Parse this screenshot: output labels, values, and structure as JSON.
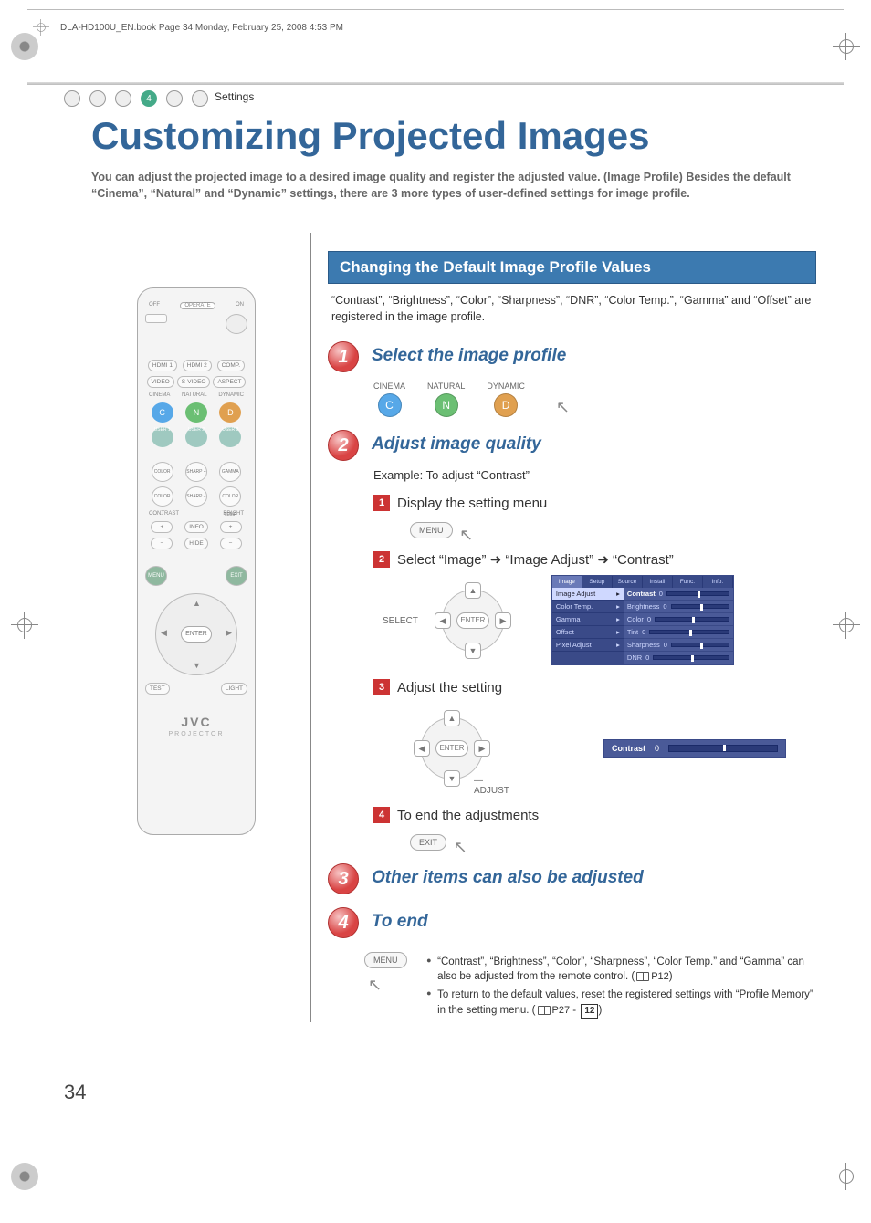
{
  "book_header": "DLA-HD100U_EN.book  Page 34  Monday, February 25, 2008  4:53 PM",
  "breadcrumb": {
    "step_number": "4",
    "label": "Settings"
  },
  "title": "Customizing Projected Images",
  "intro": "You can adjust the projected image to a desired image quality and register the adjusted value. (Image Profile)  Besides the default “Cinema”, “Natural” and “Dynamic” settings, there are 3 more types of user-defined settings for image profile.",
  "section": {
    "bar": "Changing the Default Image Profile Values",
    "desc": "“Contrast”, “Brightness”, “Color”, “Sharpness”, “DNR”, “Color Temp.”, “Gamma” and “Offset” are registered in the image profile."
  },
  "steps": {
    "s1": {
      "num": "1",
      "title": "Select the image profile",
      "profiles": [
        {
          "label": "CINEMA",
          "letter": "C",
          "cls": "c"
        },
        {
          "label": "NATURAL",
          "letter": "N",
          "cls": "n"
        },
        {
          "label": "DYNAMIC",
          "letter": "D",
          "cls": "d"
        }
      ]
    },
    "s2": {
      "num": "2",
      "title": "Adjust image quality",
      "example": "Example: To adjust “Contrast”",
      "sub1": {
        "n": "1",
        "text": "Display the setting menu",
        "btn": "MENU"
      },
      "sub2": {
        "n": "2",
        "text": "Select “Image” ➜ “Image Adjust” ➜ “Contrast”",
        "select_label": "SELECT",
        "enter": "ENTER"
      },
      "sub3": {
        "n": "3",
        "text": "Adjust the setting",
        "enter": "ENTER",
        "adjust": "ADJUST",
        "contrast_label": "Contrast",
        "contrast_value": "0"
      },
      "sub4": {
        "n": "4",
        "text": "To end the adjustments",
        "btn": "EXIT"
      }
    },
    "s3": {
      "num": "3",
      "title": "Other items can also be adjusted"
    },
    "s4": {
      "num": "4",
      "title": "To end",
      "btn": "MENU",
      "bullets": [
        "“Contrast”, “Brightness”, “Color”, “Sharpness”, “Color Temp.” and “Gamma” can also be adjusted from the remote control. (",
        "To return to the default values, reset the registered settings with “Profile Memory” in the setting menu. ("
      ],
      "ref1": "P12",
      "ref2": "P27",
      "ref2b": "12"
    }
  },
  "menu": {
    "tabs": [
      "Image",
      "Setup",
      "Source",
      "Install",
      "Func.",
      "Info."
    ],
    "left": [
      "Image Adjust",
      "Color Temp.",
      "Gamma",
      "Offset",
      "Pixel Adjust"
    ],
    "right": [
      {
        "lbl": "Contrast",
        "val": "0",
        "sel": true
      },
      {
        "lbl": "Brightness",
        "val": "0"
      },
      {
        "lbl": "Color",
        "val": "0"
      },
      {
        "lbl": "Tint",
        "val": "0"
      },
      {
        "lbl": "Sharpness",
        "val": "0"
      },
      {
        "lbl": "DNR",
        "val": "0"
      }
    ]
  },
  "remote": {
    "power": {
      "off": "OFF",
      "operate": "OPERATE",
      "on": "ON"
    },
    "inputs_row1": [
      "HDMI 1",
      "HDMI 2",
      "COMP."
    ],
    "inputs_row2": [
      "VIDEO",
      "S-VIDEO",
      "ASPECT"
    ],
    "profile_labels": [
      "CINEMA",
      "NATURAL",
      "DYNAMIC"
    ],
    "profiles": [
      {
        "l": "C",
        "c": "c"
      },
      {
        "l": "N",
        "c": "n"
      },
      {
        "l": "D",
        "c": "d"
      }
    ],
    "users": [
      "USER 1",
      "USER 2",
      "USER 3"
    ],
    "adj_row1": [
      "COLOR +",
      "SHARP +",
      "GAMMA"
    ],
    "adj_row2": [
      "COLOR −",
      "SHARP −",
      "COLOR TEMP"
    ],
    "cb_labels": {
      "l": "CONTRAST",
      "r": "BRIGHT"
    },
    "info": "INFO",
    "hide": "HIDE",
    "menu": "MENU",
    "exit": "EXIT",
    "enter": "ENTER",
    "test": "TEST",
    "light": "LIGHT",
    "brand": "JVC",
    "brand_sub": "PROJECTOR"
  },
  "page_number": "34"
}
